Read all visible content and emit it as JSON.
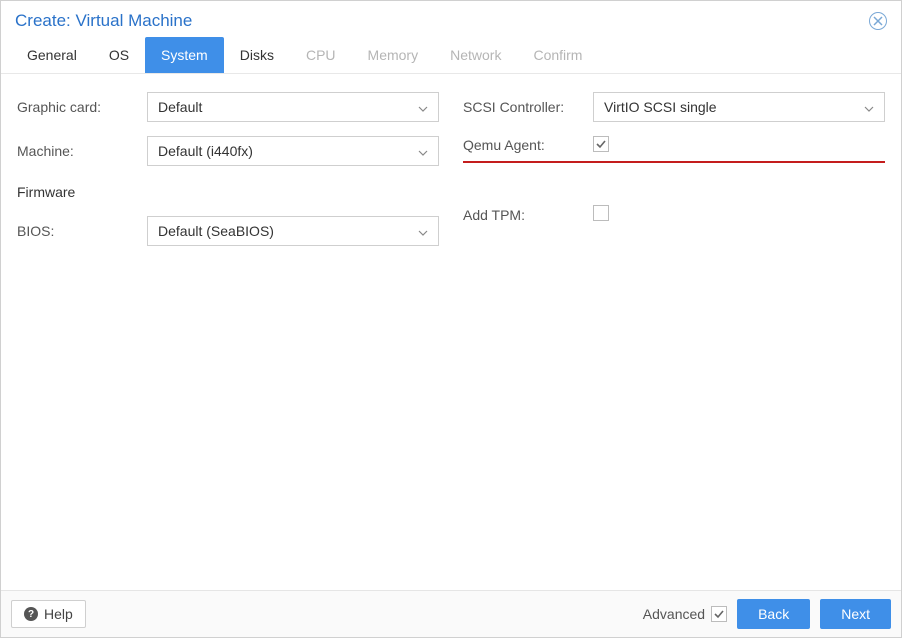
{
  "title": "Create: Virtual Machine",
  "tabs": [
    {
      "label": "General",
      "state": "enabled"
    },
    {
      "label": "OS",
      "state": "enabled"
    },
    {
      "label": "System",
      "state": "active"
    },
    {
      "label": "Disks",
      "state": "enabled"
    },
    {
      "label": "CPU",
      "state": "disabled"
    },
    {
      "label": "Memory",
      "state": "disabled"
    },
    {
      "label": "Network",
      "state": "disabled"
    },
    {
      "label": "Confirm",
      "state": "disabled"
    }
  ],
  "left": {
    "graphic_card": {
      "label": "Graphic card:",
      "value": "Default"
    },
    "machine": {
      "label": "Machine:",
      "value": "Default (i440fx)"
    },
    "firmware_section": "Firmware",
    "bios": {
      "label": "BIOS:",
      "value": "Default (SeaBIOS)"
    }
  },
  "right": {
    "scsi": {
      "label": "SCSI Controller:",
      "value": "VirtIO SCSI single"
    },
    "qemu": {
      "label": "Qemu Agent:",
      "checked": true
    },
    "tpm": {
      "label": "Add TPM:",
      "checked": false
    }
  },
  "footer": {
    "help": "Help",
    "advanced": {
      "label": "Advanced",
      "checked": true
    },
    "back": "Back",
    "next": "Next"
  }
}
